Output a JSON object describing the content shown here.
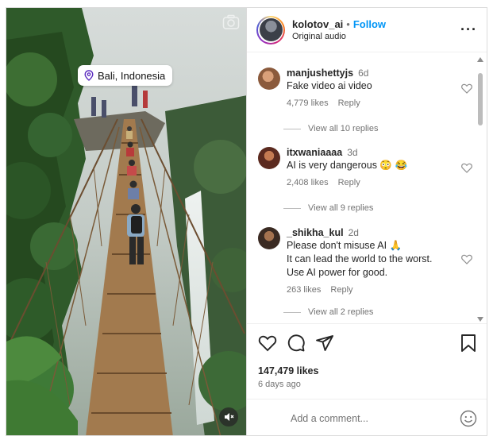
{
  "media": {
    "location": "Bali, Indonesia"
  },
  "header": {
    "username": "kolotov_ai",
    "separator": "•",
    "follow_label": "Follow",
    "subtitle": "Original audio",
    "more_label": "···"
  },
  "comments": [
    {
      "user": "manjushettyjs",
      "time": "6d",
      "text_lines": [
        "Fake video ai video"
      ],
      "likes": "4,779 likes",
      "reply_label": "Reply",
      "view_replies": "View all 10 replies",
      "avatar_color": "#8b5a3c"
    },
    {
      "user": "itxwaniaaaa",
      "time": "3d",
      "text_lines": [
        "AI is very dangerous 😳 😂"
      ],
      "likes": "2,408 likes",
      "reply_label": "Reply",
      "view_replies": "View all 9 replies",
      "avatar_color": "#5b2a1f"
    },
    {
      "user": "_shikha_kul",
      "time": "2d",
      "text_lines": [
        "Please don't misuse AI 🙏",
        "It can lead the world to the worst.",
        "Use AI power for good."
      ],
      "likes": "263 likes",
      "reply_label": "Reply",
      "view_replies": "View all 2 replies",
      "avatar_color": "#3a2a22"
    }
  ],
  "actions": {
    "likes_count": "147,479 likes",
    "posted": "6 days ago"
  },
  "add_comment": {
    "placeholder": "Add a comment..."
  },
  "colors": {
    "accent": "#0095f6",
    "secondary_text": "#737373",
    "border": "#dbdbdb"
  },
  "icons": {
    "camera": "camera-icon",
    "location": "location-pin-icon",
    "mute": "volume-off-icon",
    "more": "more-horizontal-icon",
    "like": "heart-icon",
    "comment": "comment-bubble-icon",
    "share": "send-icon",
    "save": "bookmark-icon",
    "emoji": "smiley-icon"
  }
}
